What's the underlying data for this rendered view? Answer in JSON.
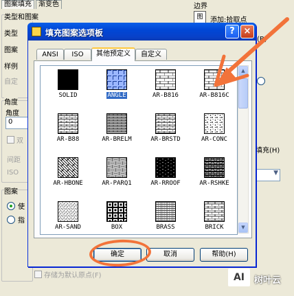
{
  "background_dialog": {
    "tabs": [
      "图案填充",
      "渐变色"
    ],
    "type_group": "类型和图案",
    "type_label": "类型",
    "pattern_label": "图案",
    "sample_label": "样例",
    "custom_label": "自定",
    "angle_group": "角度",
    "angle_label": "角度",
    "angle_value": "0",
    "double_label": "双",
    "spacing_label": "间距",
    "iso_label": "ISO",
    "origin_group": "图案",
    "use_current_label": "使",
    "specify_label": "指",
    "store_default_label": "存储为默认原点(F)",
    "right_group": "边界",
    "add_pick_label": "添加:拾取点",
    "fill_label": "填充(H)",
    "pick_suffix": "(B)"
  },
  "dialog": {
    "title": "填充图案选项板",
    "help_btn": "?",
    "close_btn": "×",
    "tabs": [
      {
        "label": "ANSI",
        "active": false
      },
      {
        "label": "ISO",
        "active": false
      },
      {
        "label": "其他预定义",
        "active": true
      },
      {
        "label": "自定义",
        "active": false
      }
    ],
    "patterns": [
      {
        "name": "SOLID",
        "pattern": "solid"
      },
      {
        "name": "ANGLE",
        "pattern": "angle",
        "selected": true
      },
      {
        "name": "AR-B816",
        "pattern": "brick-large"
      },
      {
        "name": "AR-B816C",
        "pattern": "brick-large"
      },
      {
        "name": "AR-B88",
        "pattern": "brick-small"
      },
      {
        "name": "AR-BRELM",
        "pattern": "brick-elm"
      },
      {
        "name": "AR-BRSTD",
        "pattern": "brick-small"
      },
      {
        "name": "AR-CONC",
        "pattern": "concrete"
      },
      {
        "name": "AR-HBONE",
        "pattern": "herringbone"
      },
      {
        "name": "AR-PARQ1",
        "pattern": "parquet"
      },
      {
        "name": "AR-RROOF",
        "pattern": "roof"
      },
      {
        "name": "AR-RSHKE",
        "pattern": "shake"
      },
      {
        "name": "AR-SAND",
        "pattern": "sand"
      },
      {
        "name": "BOX",
        "pattern": "box"
      },
      {
        "name": "BRASS",
        "pattern": "brass"
      },
      {
        "name": "BRICK",
        "pattern": "brick"
      }
    ],
    "buttons": {
      "ok": "确定",
      "cancel": "取消",
      "help": "帮助(H)"
    }
  },
  "watermark": {
    "logo": "AI",
    "text": "树叶云"
  },
  "colors": {
    "title_bar": "#0a5ee8",
    "annotation": "#f2733a",
    "selection": "#316ac5"
  }
}
